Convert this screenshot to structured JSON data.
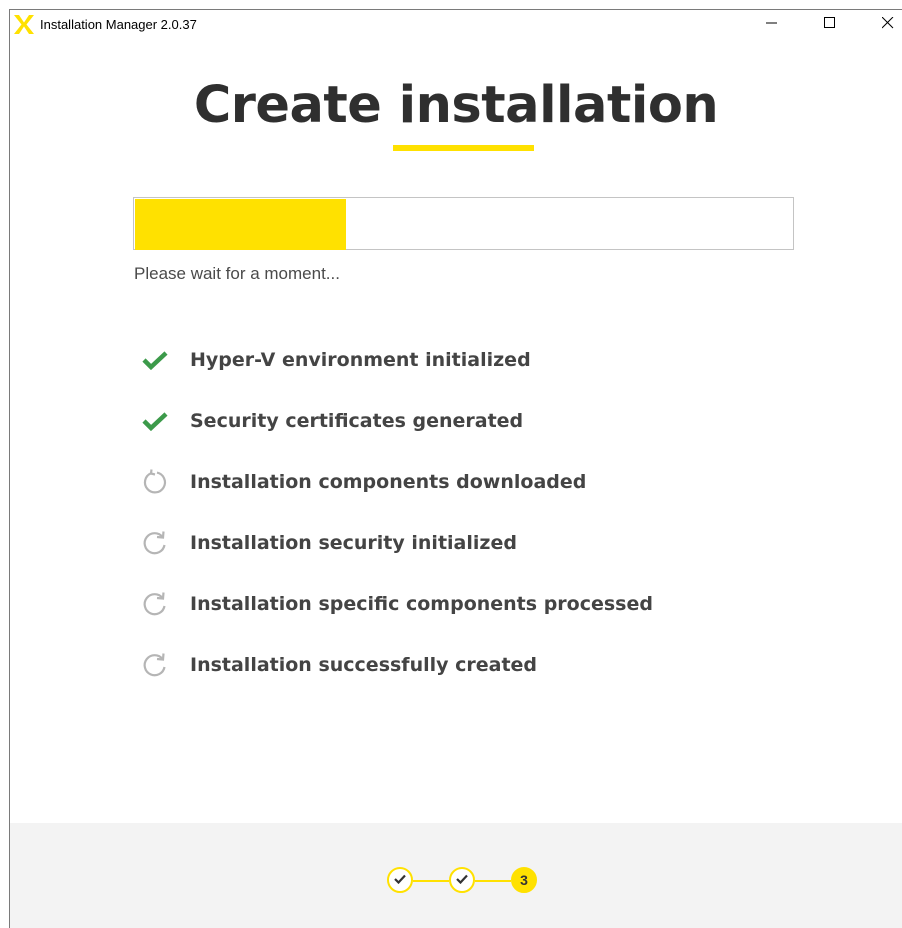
{
  "window": {
    "title": "Installation Manager 2.0.37",
    "controls": [
      "minimize",
      "maximize",
      "close"
    ]
  },
  "main": {
    "heading": "Create installation",
    "progress_fraction": 0.32,
    "status_text": "Please wait for a moment..."
  },
  "steps": [
    {
      "label": "Hyper-V environment initialized",
      "state": "done",
      "icon": "check-icon"
    },
    {
      "label": "Security certificates generated",
      "state": "done",
      "icon": "check-icon"
    },
    {
      "label": "Installation components downloaded",
      "state": "in-progress",
      "icon": "spinner-icon"
    },
    {
      "label": "Installation security initialized",
      "state": "pending",
      "icon": "refresh-icon"
    },
    {
      "label": "Installation specific components processed",
      "state": "pending",
      "icon": "refresh-icon"
    },
    {
      "label": "Installation successfully created",
      "state": "pending",
      "icon": "refresh-icon"
    }
  ],
  "wizard": {
    "steps": [
      {
        "state": "done",
        "icon": "check-icon"
      },
      {
        "state": "done",
        "icon": "check-icon"
      },
      {
        "state": "current",
        "label": "3"
      }
    ]
  },
  "colors": {
    "accent": "#ffe100",
    "check": "#3c9a4a",
    "pending": "#b5b5b5",
    "heading": "#2f2f2f"
  }
}
